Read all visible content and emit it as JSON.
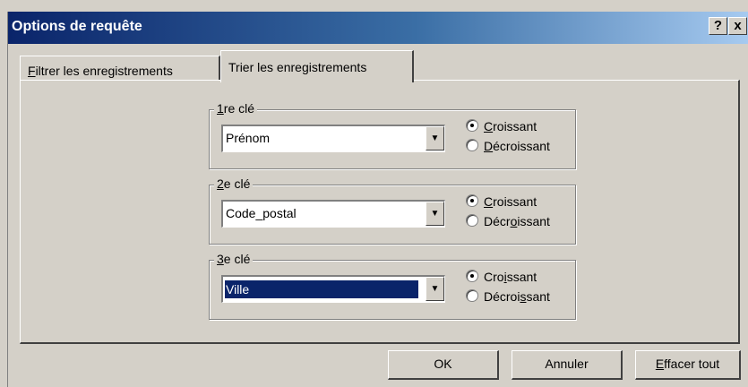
{
  "window": {
    "title": "Options de requête",
    "help_label": "?",
    "close_label": "x"
  },
  "tabs": [
    {
      "label_underlined": "F",
      "label_rest": "iltrer les enregistrements",
      "active": false
    },
    {
      "label_pre": "Trier les enre",
      "label_underlined": "g",
      "label_post": "istrements",
      "active": true
    }
  ],
  "keys": [
    {
      "legend_u": "1",
      "legend_rest": "re clé",
      "value": "Prénom",
      "asc": {
        "u": "C",
        "rest": "roissant",
        "pre": ""
      },
      "desc": {
        "pre": "",
        "u": "D",
        "rest": "écroissant"
      },
      "selected": "asc"
    },
    {
      "legend_u": "2",
      "legend_rest": "e clé",
      "value": "Code_postal",
      "asc": {
        "pre": "",
        "u": "C",
        "rest": "roissant"
      },
      "desc": {
        "pre": "Décr",
        "u": "o",
        "rest": "issant"
      },
      "selected": "asc"
    },
    {
      "legend_u": "3",
      "legend_rest": "e clé",
      "value": "Ville",
      "asc": {
        "pre": "Cro",
        "u": "i",
        "rest": "ssant"
      },
      "desc": {
        "pre": "Décroi",
        "u": "s",
        "rest": "sant"
      },
      "selected": "asc"
    }
  ],
  "buttons": {
    "ok": "OK",
    "cancel": "Annuler",
    "clear_u": "E",
    "clear_rest": "ffacer tout"
  }
}
